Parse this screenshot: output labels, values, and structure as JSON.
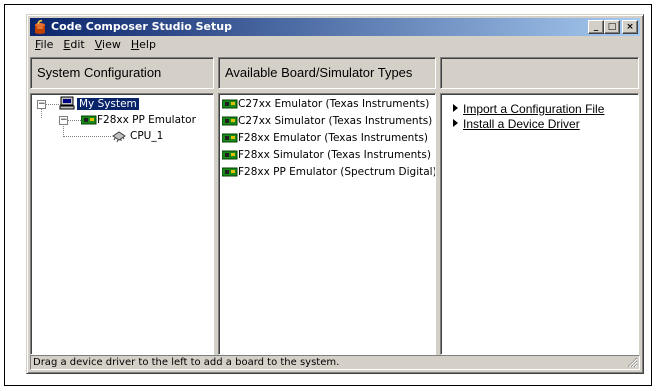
{
  "window": {
    "title": "Code Composer Studio Setup",
    "buttons": {
      "minimize": "_",
      "maximize": "□",
      "close": "×"
    }
  },
  "menu": [
    {
      "label_ul": "F",
      "label_rest": "ile"
    },
    {
      "label_ul": "E",
      "label_rest": "dit"
    },
    {
      "label_ul": "V",
      "label_rest": "iew"
    },
    {
      "label_ul": "H",
      "label_rest": "elp"
    }
  ],
  "headers": {
    "system": "System Configuration",
    "available": "Available Board/Simulator Types",
    "actions": ""
  },
  "tree": {
    "root": "My System",
    "board": "F28xx PP Emulator",
    "cpu": "CPU_1"
  },
  "boards": [
    "C27xx Emulator (Texas Instruments)",
    "C27xx Simulator (Texas Instruments)",
    "F28xx Emulator (Texas Instruments)",
    "F28xx Simulator (Texas Instruments)",
    "F28xx PP Emulator (Spectrum Digital)"
  ],
  "actions": [
    "Import a Configuration File",
    "Install a Device Driver"
  ],
  "status": "Drag a device driver to the left to add a board to the system.",
  "colors": {
    "title_start": "#0a246a",
    "title_end": "#a6caf0",
    "selection": "#0a246a",
    "chrome": "#d4d0c8"
  }
}
